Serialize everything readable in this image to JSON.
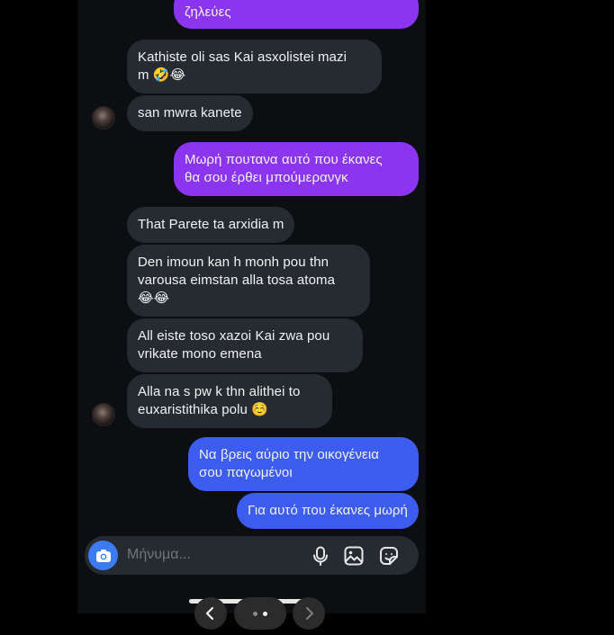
{
  "messages": {
    "m0": "ζηλεύες",
    "m1a": "Kathiste oli sas Kai asxolistei mazi",
    "m1b": "m 🤣😂",
    "m2": "san mwra kanete",
    "m3a": "Μωρή πουτανα αυτό που έκανες",
    "m3b": "θα σου έρθει μπούμερανγκ",
    "m4": "That Parete ta arxidia m",
    "m5a": "Den imoun kan h monh pou thn",
    "m5b": "varousa eimstan alla tosa atoma",
    "m5c": "😂😂",
    "m6a": "All eiste toso xazoi Kai zwa pou",
    "m6b": "vrikate mono emena",
    "m7a": "Alla na s pw k thn alithei to",
    "m7b": "euxaristithika polu ☺️",
    "m8a": "Να βρεις αύριο την οικογένεια",
    "m8b": "σου παγωμένοι",
    "m9": "Για αυτό που έκανες μωρή"
  },
  "composer": {
    "placeholder": "Μήνυμα..."
  },
  "colors": {
    "incoming": "#262a31",
    "outgoing_purple": "#8b35f0",
    "outgoing_blue": "#3d5cf0",
    "accent": "#3d7bf5"
  },
  "icons": [
    "camera-icon",
    "microphone-icon",
    "gallery-icon",
    "sticker-icon",
    "chevron-left-icon",
    "page-dots",
    "chevron-right-icon"
  ]
}
